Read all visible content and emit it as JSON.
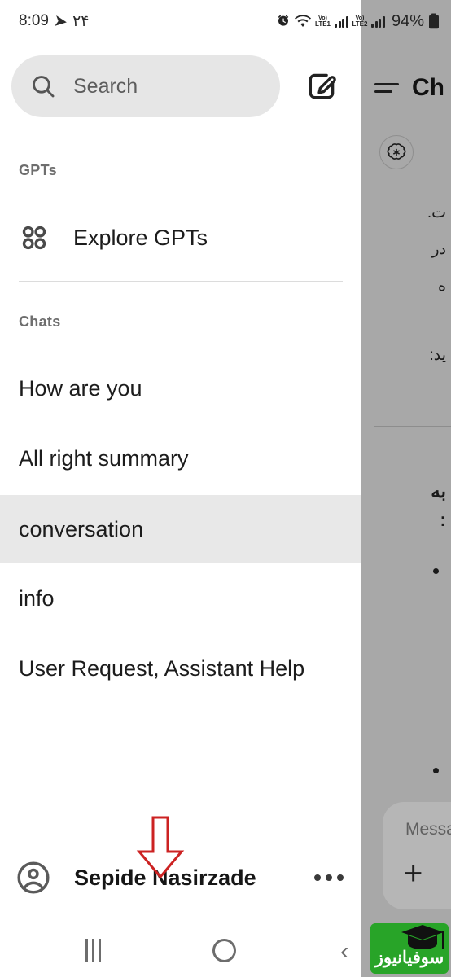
{
  "status_bar": {
    "time": "8:09",
    "nav_arrow_icon": "navigation-arrow-icon",
    "temperature": "۲۴",
    "alarm_icon": "alarm-clock-icon",
    "wifi_icon": "wifi-icon",
    "sim1_label_top": "Vo)",
    "sim1_label_bottom": "LTE1",
    "sim2_label_top": "Vo)",
    "sim2_label_bottom": "LTE2",
    "battery_percent": "94%",
    "battery_icon": "battery-icon"
  },
  "sidebar": {
    "search": {
      "icon": "search-icon",
      "placeholder": "Search",
      "value": ""
    },
    "compose_button": {
      "icon": "compose-pencil-icon",
      "label": ""
    },
    "gpts_section": {
      "label": "GPTs",
      "explore": {
        "icon": "grid-four-circles-icon",
        "label": "Explore GPTs"
      }
    },
    "chats_section": {
      "label": "Chats",
      "items": [
        {
          "label": "How are you",
          "active": false
        },
        {
          "label": "All right summary",
          "active": false
        },
        {
          "label": "conversation",
          "active": true
        },
        {
          "label": "info",
          "active": false
        },
        {
          "label": "User Request, Assistant Help",
          "active": false
        }
      ]
    },
    "account": {
      "avatar_icon": "user-circle-avatar-icon",
      "name": "Sepide Nasirzade",
      "more_icon": "three-dots-menu-icon"
    }
  },
  "annotation": {
    "arrow_icon": "red-down-arrow-icon",
    "color": "#cc2222"
  },
  "chat_panel": {
    "menu_icon": "hamburger-menu-icon",
    "title": "Ch",
    "assistant_logo_icon": "openai-logo-icon",
    "message_lines": [
      "ت.",
      "در",
      "ه",
      "ید:"
    ],
    "bullet_text": "به",
    "bullet_text_2": ":",
    "composer": {
      "placeholder": "Messa",
      "plus_icon": "plus-icon"
    }
  },
  "nav_bar": {
    "recents_icon": "recents-button-icon",
    "home_icon": "home-button-icon",
    "back_icon": "back-button-icon"
  },
  "watermark": {
    "text": "سوفیانیوز",
    "cap_icon": "graduation-cap-icon",
    "background_color": "#28a428"
  }
}
